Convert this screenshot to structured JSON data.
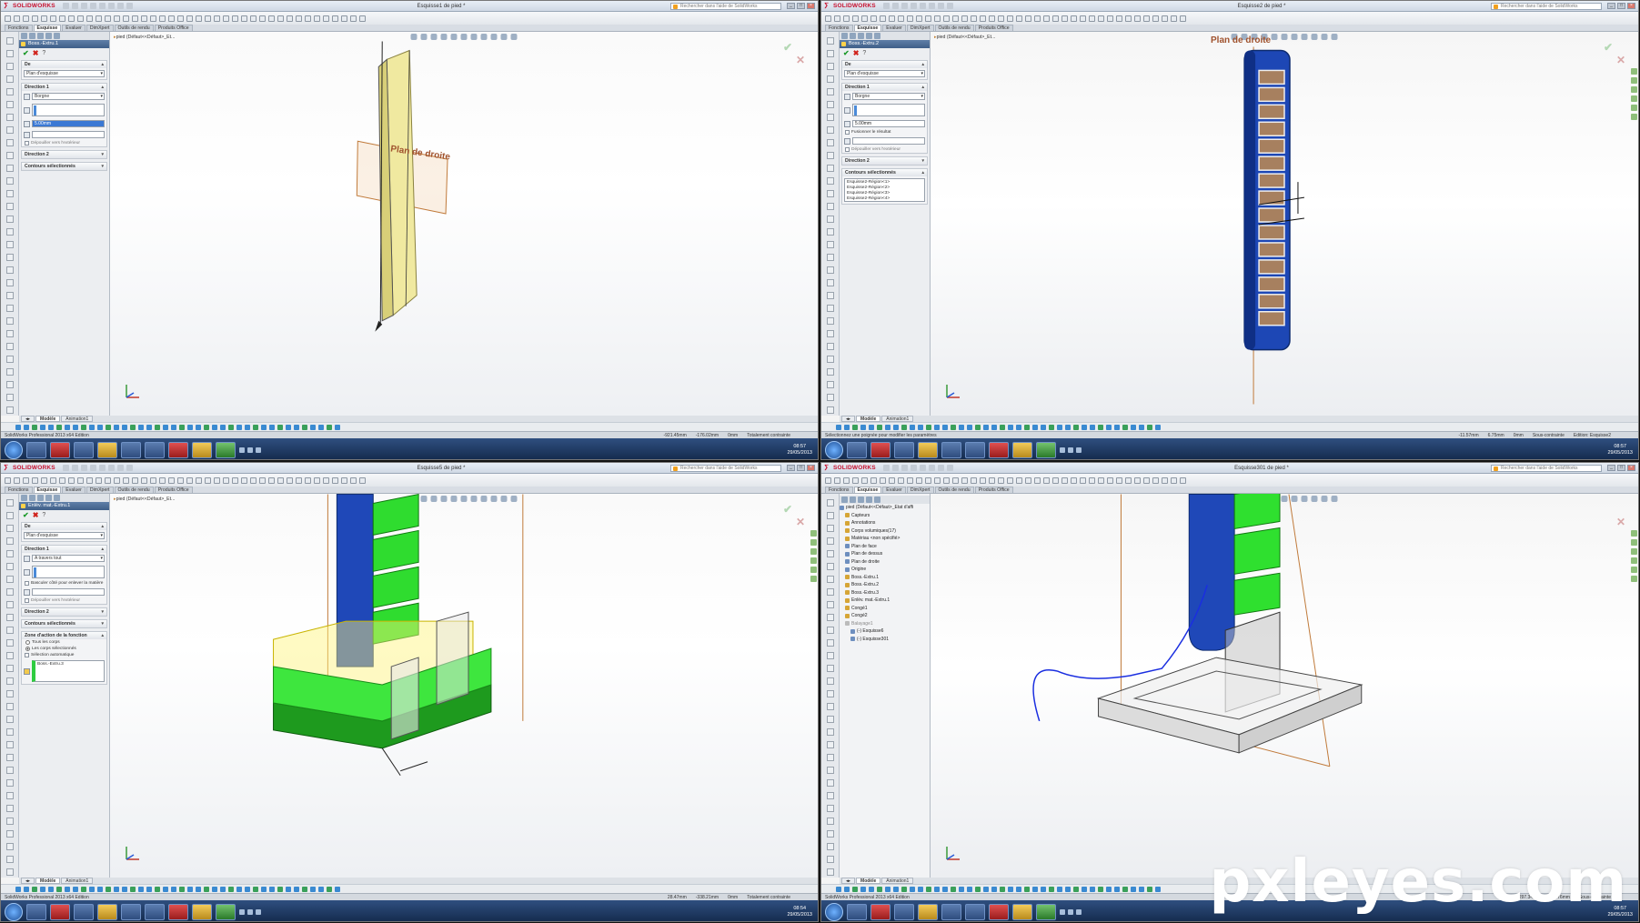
{
  "app_name": "SOLIDWORKS",
  "search_placeholder": "Rechercher dans l'aide de SolidWorks",
  "tabs": [
    "Fonctions",
    "Esquisse",
    "Evaluer",
    "DimXpert",
    "Outils de rendu",
    "Produits Office"
  ],
  "model_tabs": [
    "Modèle",
    "Animation1"
  ],
  "windows": [
    {
      "doc_title": "Esquisse1 de pied *",
      "active_tab": "Esquisse",
      "feature_title": "Boss.-Extru.1",
      "de_label": "De",
      "de_value": "Plan d'esquisse",
      "dir1_label": "Direction 1",
      "dir1_type": "Borgne",
      "depth": "5.00mm",
      "reverse_label": "Dépouiller vers l'extérieur",
      "dir2_label": "Direction 2",
      "contours_label": "Contours sélectionnés",
      "breadcrumb": "pied (Défaut<<Défaut>_Et...",
      "plane_label": "Plan de droite",
      "status_msg": "SolidWorks Professional 2013 x64 Edition",
      "coords": [
        "-921.45mm",
        "-176.02mm",
        "0mm"
      ],
      "constraint": "Totalement contrainte",
      "time": "08:57",
      "date": "29/05/2013"
    },
    {
      "doc_title": "Esquisse2 de pied *",
      "active_tab": "Esquisse",
      "feature_title": "Boss.-Extru.2",
      "de_label": "De",
      "de_value": "Plan d'esquisse",
      "dir1_label": "Direction 1",
      "dir1_type": "Borgne",
      "depth": "5.00mm",
      "merge_label": "Fusionner le résultat",
      "reverse_label": "Dépouiller vers l'extérieur",
      "dir2_label": "Direction 2",
      "contours_label": "Contours sélectionnés",
      "contours": [
        "Esquisse2-Région<1>",
        "Esquisse2-Région<2>",
        "Esquisse2-Région<3>",
        "Esquisse2-Région<4>"
      ],
      "breadcrumb": "pied (Défaut<<Défaut>_Et...",
      "plane_label": "Plan de droite",
      "status_msg": "Sélectionnez une poignée pour modifier les paramètres",
      "coords": [
        "-11.57mm",
        "6.75mm",
        "0mm"
      ],
      "constraint": "Sous-contrainte",
      "edit_label": "Edition: Esquisse2",
      "time": "08:57",
      "date": "29/05/2013"
    },
    {
      "doc_title": "Esquisse5 de pied *",
      "active_tab": "Esquisse",
      "feature_title": "Enlèv. mat.-Extru.1",
      "de_label": "De",
      "de_value": "Plan d'esquisse",
      "dir1_label": "Direction 1",
      "dir1_type": "A travers tout",
      "flip_label": "Basculer côté pour enlever la matière",
      "reverse_label": "Dépouiller vers l'extérieur",
      "dir2_label": "Direction 2",
      "contours_label": "Contours sélectionnés",
      "zone_label": "Zone d'action de la fonction",
      "zone_options": [
        "Tous les corps",
        "Les corps sélectionnés",
        "Sélection automatique"
      ],
      "zone_body": "Boss.-Extru.3",
      "breadcrumb": "pied (Défaut<<Défaut>_Et...",
      "status_msg": "SolidWorks Professional 2013 x64 Edition",
      "coords": [
        "28.47mm",
        "-338.21mm",
        "0mm"
      ],
      "constraint": "Totalement contrainte",
      "time": "08:54",
      "date": "29/05/2013"
    },
    {
      "doc_title": "Esquisse301 de pied *",
      "active_tab": "Esquisse",
      "tree": [
        {
          "label": "pied (Défaut<<Défaut>_Etat d'affi",
          "kind": "part"
        },
        {
          "label": "Capteurs",
          "kind": "folder"
        },
        {
          "label": "Annotations",
          "kind": "folder"
        },
        {
          "label": "Corps volumiques(17)",
          "kind": "folder"
        },
        {
          "label": "Matériau <non spécifié>",
          "kind": "folder"
        },
        {
          "label": "Plan de face",
          "kind": "plane"
        },
        {
          "label": "Plan de dessus",
          "kind": "plane"
        },
        {
          "label": "Plan de droite",
          "kind": "plane"
        },
        {
          "label": "Origine",
          "kind": "plane"
        },
        {
          "label": "Boss.-Extru.1",
          "kind": "feature"
        },
        {
          "label": "Boss.-Extru.2",
          "kind": "feature"
        },
        {
          "label": "Boss.-Extru.3",
          "kind": "feature"
        },
        {
          "label": "Enlèv. mat.-Extru.1",
          "kind": "feature"
        },
        {
          "label": "Congé1",
          "kind": "feature"
        },
        {
          "label": "Congé2",
          "kind": "feature"
        },
        {
          "label": "Balayage1",
          "kind": "gray"
        },
        {
          "label": "(-) Esquisse6",
          "kind": "sketch"
        },
        {
          "label": "(-) Esquisse301",
          "kind": "sketch"
        }
      ],
      "status_msg": "SolidWorks Professional 2013 x64 Edition",
      "coords": [
        "-297.34mm",
        "-34.76mm"
      ],
      "constraint": "Sous-contrainte",
      "time": "08:57",
      "date": "29/05/2013"
    }
  ],
  "watermark": "pxleyes.com"
}
